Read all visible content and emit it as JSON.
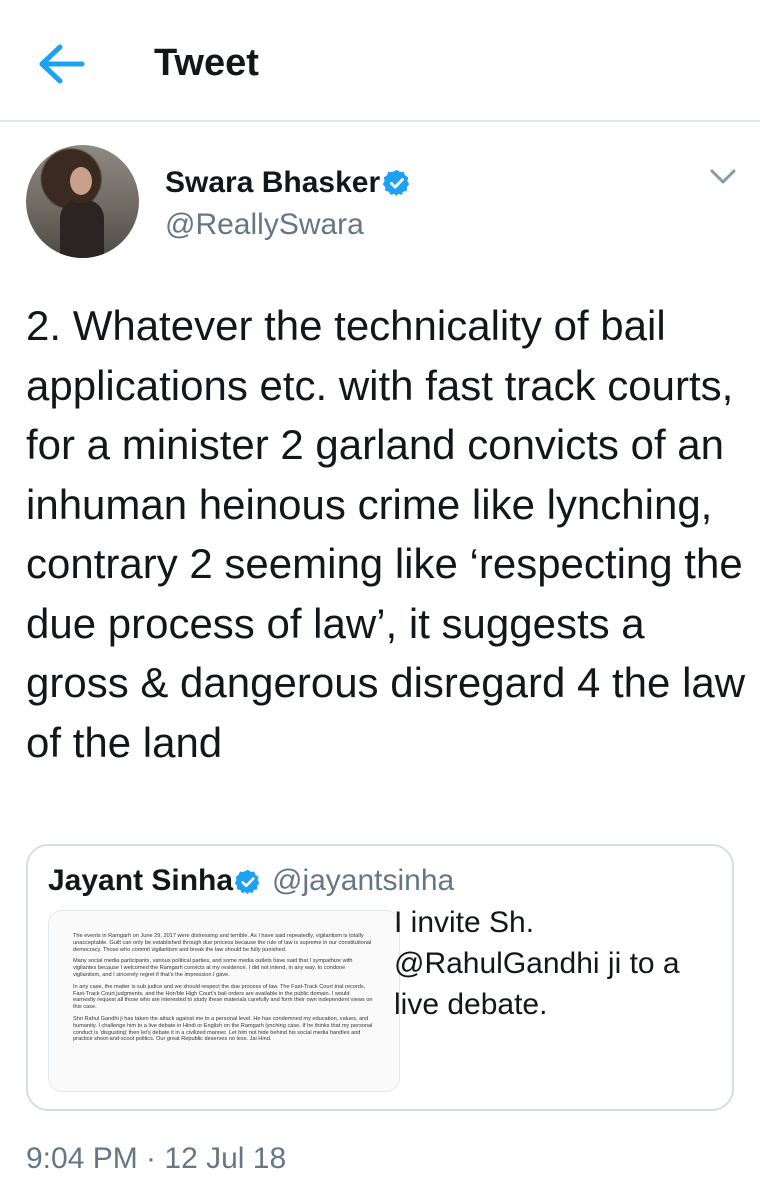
{
  "header": {
    "title": "Tweet",
    "accent_color": "#1da1f2"
  },
  "tweet": {
    "author_name": "Swara Bhasker",
    "author_handle": "@ReallySwara",
    "verified": true,
    "text": "2. Whatever the technicality of bail applications etc. with fast track courts, for a minister 2 garland convicts of an inhuman heinous crime like lynching, contrary 2 seeming like ‘respecting the due process of law’, it suggests a gross & dangerous disregard 4 the law of the land",
    "timestamp": "9:04 PM · 12 Jul 18"
  },
  "quoted": {
    "author_name": "Jayant Sinha",
    "author_handle": "@jayantsinha",
    "verified": true,
    "text_prefix": "I invite Sh. ",
    "mention": "@RahulGandhi",
    "text_suffix": " ji to a live debate.",
    "image_paragraphs": [
      "The events in Ramgarh on June 29, 2017 were distressing and terrible. As I have said repeatedly, vigilantism is totally unacceptable. Guilt can only be established through due process because the rule of law is supreme in our constitutional democracy. Those who commit vigilantism and break the law should be fully punished.",
      "Many social media participants, various political parties, and some media outlets have said that I sympathize with vigilantes because I welcomed the Ramgarh convicts at my residence. I did not intend, in any way, to condone vigilantism, and I sincerely regret if that's the impression I gave.",
      "In any case, the matter is sub judice and we should respect the due process of law. The Fast-Track Court trial records, Fast-Track Court judgments, and the Hon'ble High Court's bail orders are available in the public domain. I would earnestly request all those who are interested to study these materials carefully and form their own independent views on this case.",
      "Shri Rahul Gandhi ji has taken the attack against me to a personal level. He has condemned my education, values, and humanity. I challenge him to a live debate in Hindi or English on the Ramgarh lynching case. If he thinks that my personal conduct is 'disgusting' then let's debate it in a civilized manner. Let him not hide behind his social media handles and practice shoot-and-scoot politics. Our great Republic deserves no less. Jai Hind."
    ]
  },
  "icons": {
    "back": "arrow-left-icon",
    "verified": "verified-badge-icon",
    "menu": "chevron-down-icon"
  }
}
